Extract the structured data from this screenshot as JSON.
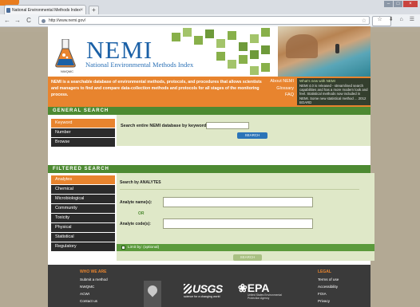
{
  "browser": {
    "tab_title": "National Environmental Methods Index",
    "new_tab": "+",
    "url": "http://www.nemi.gov/",
    "back": "←",
    "forward": "→",
    "reload": "C",
    "home": "⌂",
    "toolbar_icons": "☆ ⬇ ⌂ ☰"
  },
  "header": {
    "logo_text": "NEMI",
    "subtitle": "National Environmental Methods Index",
    "nwqmc_label": "NWQMC",
    "intro": "NEMI is a searchable database of environmental methods, protocols, and procedures that allows scientists and managers to find and compare data-collection methods and protocols for all stages of the monitoring process.",
    "quick_links": [
      "About NEMI",
      "Glossary",
      "FAQ"
    ],
    "news_title": "What's new with NEMI",
    "news_body": "NEMI 4.0 is released - streamlined search capabilities and has a more modern look and feel. Statistical methods now included in NEMI. Some new statistical method ... 2012 BOARD"
  },
  "general_search": {
    "title": "GENERAL SEARCH",
    "sidebar": [
      "Keyword",
      "Number",
      "Browse"
    ],
    "active": 0,
    "label": "Search entire NEMI database by keyword:",
    "button": "SEARCH"
  },
  "filtered_search": {
    "title": "FILTERED SEARCH",
    "sidebar": [
      "Analytes",
      "Chemical",
      "Microbiological",
      "Community",
      "Toxicity",
      "Physical",
      "Statistical",
      "Regulatory"
    ],
    "active": 0,
    "panel_title": "Search by ANALYTES",
    "analyte_name_label": "Analyte name(s):",
    "or_label": "OR",
    "analyte_code_label": "Analyte code(s):",
    "limit_label": "Limit by: (optional)",
    "button": "SEARCH"
  },
  "footer": {
    "who_title": "WHO WE ARE",
    "who_links": [
      "Submit a method",
      "NWQMC",
      "ACWI",
      "Contact us"
    ],
    "legal_title": "LEGAL",
    "legal_links": [
      "Terms of use",
      "Accessibility",
      "FOIA",
      "Privacy"
    ],
    "usgs": "USGS",
    "usgs_tag": "science for a changing world",
    "epa": "EPA",
    "epa_tag": "United States Environmental Protection Agency"
  },
  "colors": {
    "orange": "#e8842e",
    "green": "#4d8a32",
    "panel": "#dfe8c8",
    "blue": "#1a60a6",
    "dark": "#2b2b2b"
  }
}
